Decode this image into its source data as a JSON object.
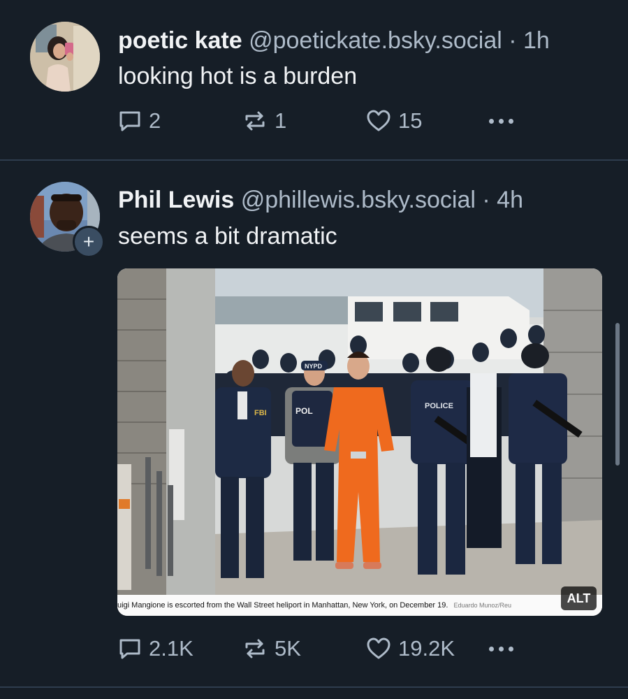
{
  "posts": [
    {
      "display_name": "poetic kate",
      "handle": "@poetickate.bsky.social",
      "time": "· 1h",
      "text": "looking hot is a burden",
      "replies": "2",
      "reposts": "1",
      "likes": "15"
    },
    {
      "display_name": "Phil Lewis",
      "handle": "@phillewis.bsky.social",
      "time": "· 4h",
      "text": "seems a bit dramatic",
      "follow_label": "+",
      "image": {
        "caption": "uigi Mangione is escorted from the Wall Street heliport in Manhattan, New York, on December 19.",
        "credit": "Eduardo Munoz/Reu",
        "alt_label": "ALT",
        "uniform_text": "POLICE",
        "cap_text": "NYPD",
        "jacket_text": "FBI"
      },
      "replies": "2.1K",
      "reposts": "5K",
      "likes": "19.2K"
    }
  ],
  "icons": {
    "reply": "speech-bubble-icon",
    "repost": "repost-arrows-icon",
    "like": "heart-icon",
    "more": "ellipsis-icon"
  },
  "colors": {
    "background": "#161e27",
    "divider": "#2e3d4e",
    "muted": "#aebbc9",
    "text": "#f1f3f5",
    "prisoner_orange": "#ef6a1e"
  }
}
